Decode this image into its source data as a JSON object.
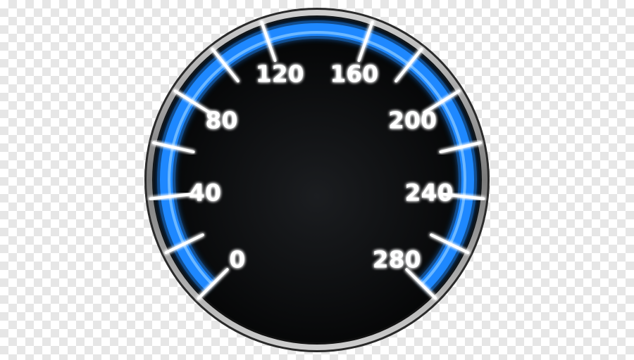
{
  "gauge": {
    "scale_min": 0,
    "scale_max": 280,
    "major_labels": [
      "0",
      "40",
      "80",
      "120",
      "160",
      "200",
      "240",
      "280"
    ],
    "major_tick_count": 15,
    "colors": {
      "face": "#050607",
      "bezel": "#9a9a9a",
      "arc_glow": "#1e88ff",
      "tick": "#ffffff",
      "label": "#ffffff"
    }
  }
}
